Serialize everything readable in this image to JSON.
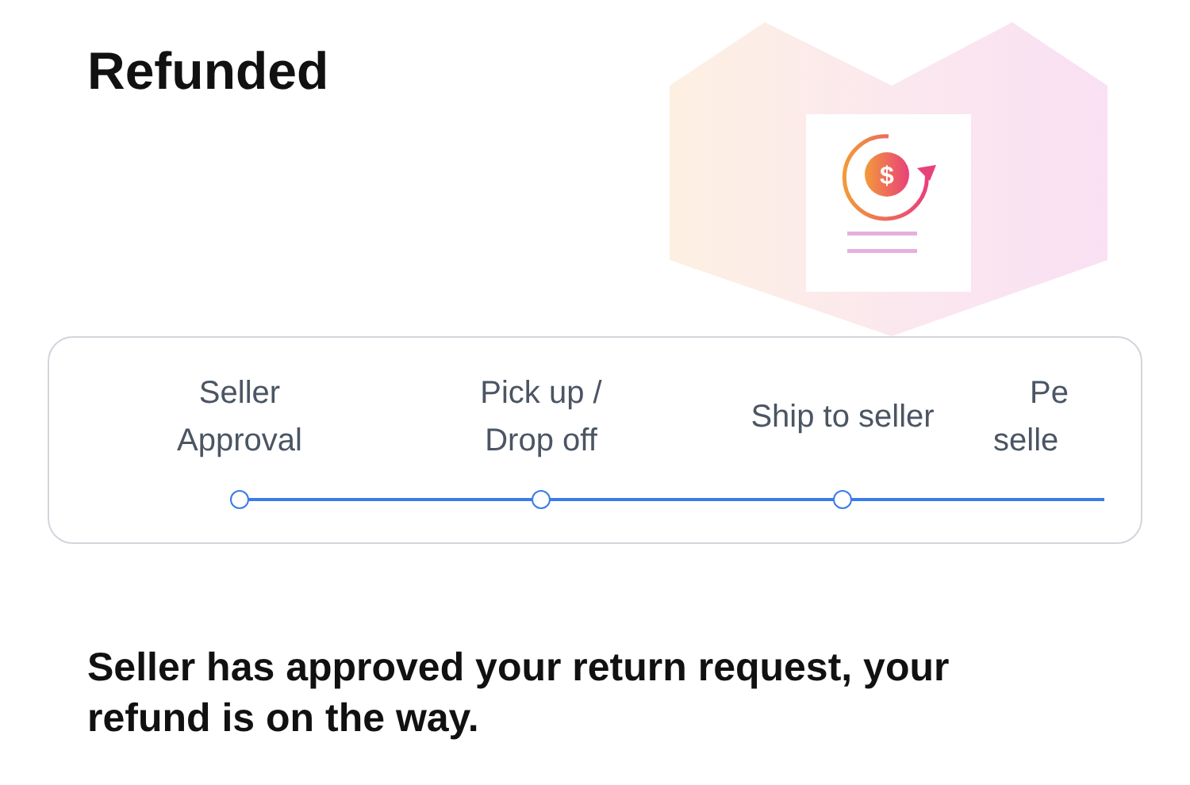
{
  "title": "Refunded",
  "illustration_symbol": "$",
  "steps": [
    {
      "lines": [
        "Seller",
        "Approval"
      ]
    },
    {
      "lines": [
        "Pick up /",
        "Drop off"
      ]
    },
    {
      "lines": [
        "Ship to seller"
      ]
    },
    {
      "lines": [
        "Pe",
        "selle"
      ],
      "cut": true
    }
  ],
  "message": "Seller has approved your return request, your refund is on the way."
}
